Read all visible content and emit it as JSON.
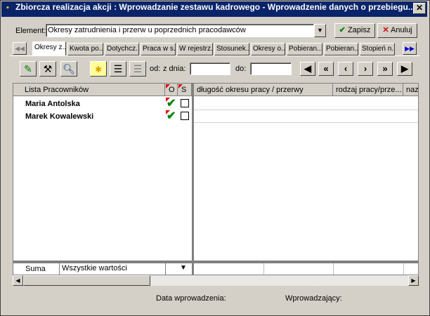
{
  "window": {
    "title": "Zbiorcza realizacja akcji :  Wprowadzanie zestawu kadrowego - Wprowadzenie danych o przebiegu...",
    "close_glyph": "✕"
  },
  "element": {
    "label": "Element:",
    "value": "Okresy zatrudnienia i przerw u poprzednich pracodawców"
  },
  "buttons": {
    "save": "Zapisz",
    "cancel": "Anuluj"
  },
  "tabs": [
    "Okresy z...",
    "Kwota po...",
    "Dotychcz...",
    "Praca w s...",
    "W rejestrz...",
    "Stosunek...",
    "Okresy o...",
    "Pobieran...",
    "Pobieran...",
    "Stopień n..."
  ],
  "date_filter": {
    "from_label": "od:",
    "date_label": "z dnia:",
    "to_label": "do:"
  },
  "grid": {
    "columns": [
      "Lista Pracowników",
      "O",
      "S",
      "długość okresu pracy / przerwy",
      "rodzaj pracy/prze...",
      "naz"
    ],
    "rows": [
      {
        "name": "Maria Antolska",
        "o_checked": true,
        "s_checked": false
      },
      {
        "name": "Marek Kowalewski",
        "o_checked": true,
        "s_checked": false
      }
    ],
    "footer": {
      "label": "Suma",
      "dropdown": "Wszystkie wartości"
    }
  },
  "status": {
    "date_label": "Data wprowadzenia:",
    "user_label": "Wprowadzający:"
  },
  "colors": {
    "title_bg": "#0a246a",
    "check_green": "#008000",
    "cancel_red": "#cc0000"
  }
}
